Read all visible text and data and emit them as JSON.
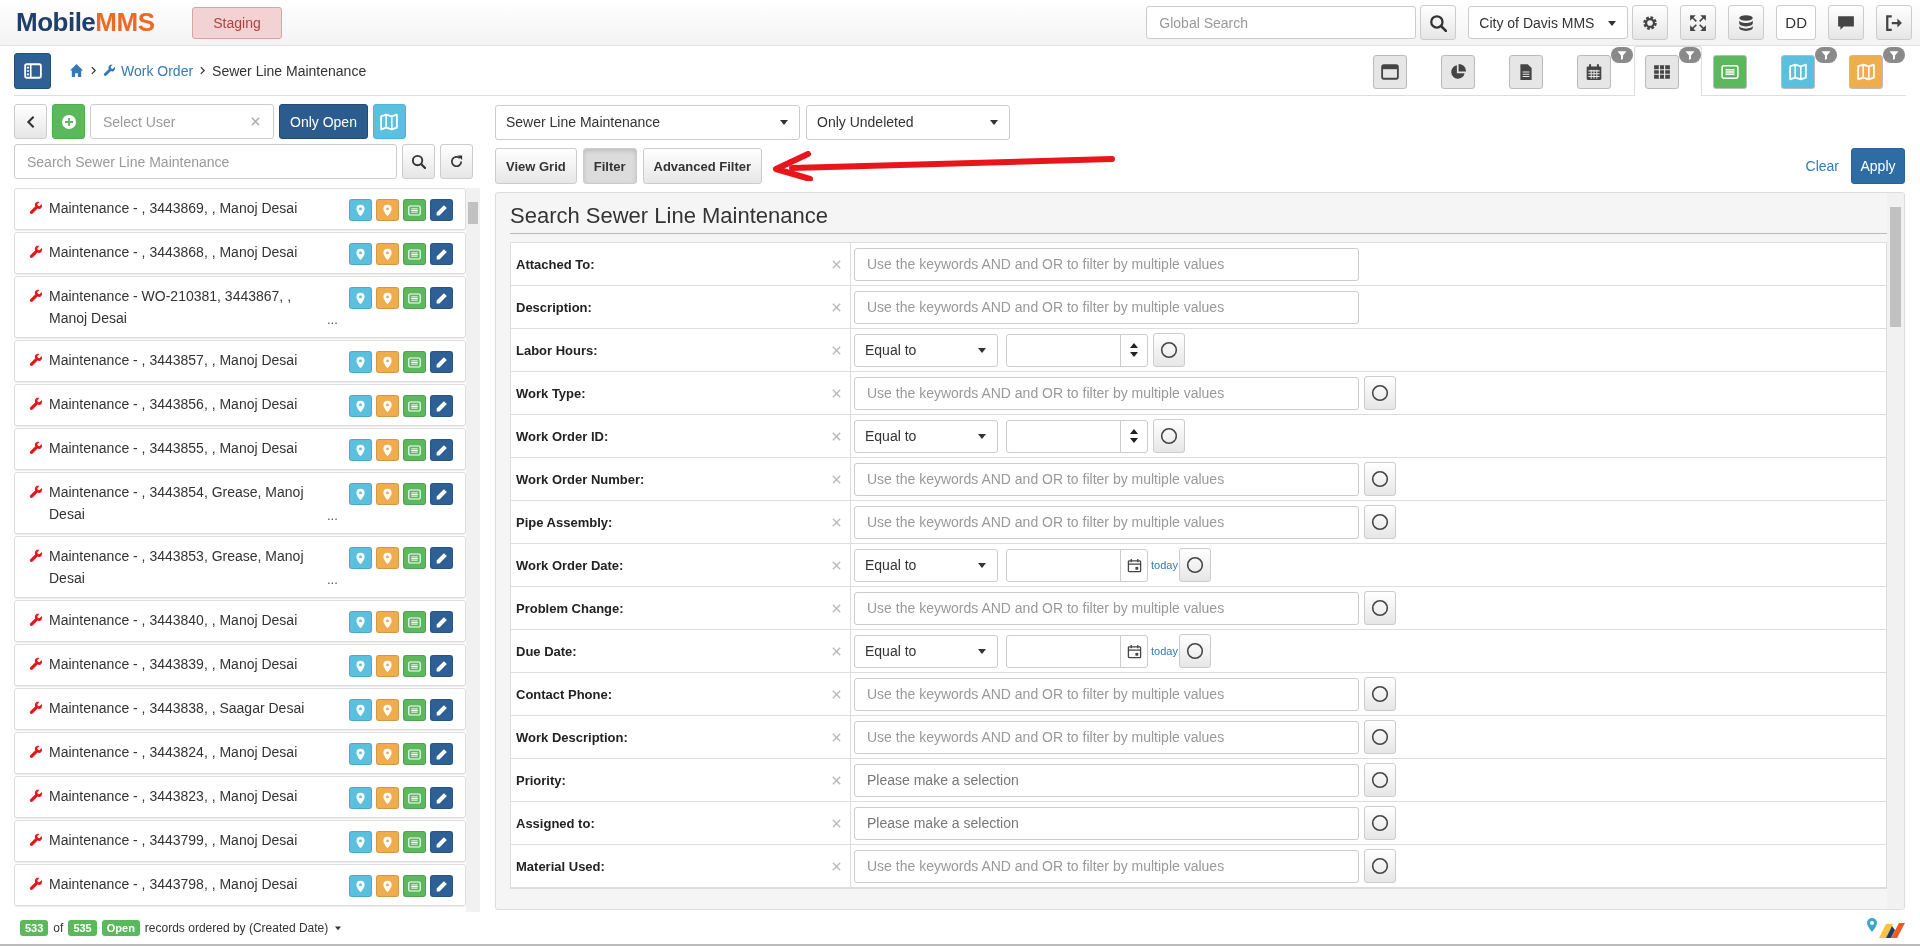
{
  "header": {
    "logo": {
      "brand": "Mobile",
      "product": "MMS"
    },
    "environment": "Staging",
    "global_search": {
      "placeholder": "Global Search"
    },
    "organization": "City of Davis MMS",
    "user_initials": "DD"
  },
  "breadcrumb": {
    "items": [
      "Work Order",
      "Sewer Line Maintenance"
    ]
  },
  "view_toolbar": [
    {
      "kind": "window",
      "color": "#e6e6e6",
      "filter_badge": false,
      "selected": false
    },
    {
      "kind": "pie",
      "color": "#e6e6e6",
      "filter_badge": false,
      "selected": false
    },
    {
      "kind": "document",
      "color": "#e6e6e6",
      "filter_badge": false,
      "selected": false
    },
    {
      "kind": "calendar",
      "color": "#e6e6e6",
      "filter_badge": true,
      "selected": false
    },
    {
      "kind": "grid",
      "color": "#e6e6e6",
      "filter_badge": true,
      "selected": true
    },
    {
      "kind": "list",
      "color": "#5cb85c",
      "filter_badge": false,
      "selected": false
    },
    {
      "kind": "map",
      "color": "#5bc0de",
      "filter_badge": true,
      "selected": false
    },
    {
      "kind": "map",
      "color": "#f0ad4e",
      "filter_badge": true,
      "selected": false
    }
  ],
  "sidebar": {
    "user_select": {
      "placeholder": "Select User"
    },
    "only_open": {
      "label": "Only Open",
      "on": true
    },
    "search": {
      "placeholder": "Search Sewer Line Maintenance"
    },
    "items": [
      {
        "text": "Maintenance - , 3443869, , Manoj Desai"
      },
      {
        "text": "Maintenance - , 3443868, , Manoj Desai"
      },
      {
        "text": "Maintenance - WO-210381, 3443867, , Manoj Desai",
        "ellipsis": "..."
      },
      {
        "text": "Maintenance - , 3443857, , Manoj Desai"
      },
      {
        "text": "Maintenance - , 3443856, , Manoj Desai"
      },
      {
        "text": "Maintenance - , 3443855, , Manoj Desai"
      },
      {
        "text": "Maintenance - , 3443854, Grease, Manoj Desai",
        "ellipsis": "..."
      },
      {
        "text": "Maintenance - , 3443853, Grease, Manoj Desai",
        "ellipsis": "..."
      },
      {
        "text": "Maintenance - , 3443840, , Manoj Desai"
      },
      {
        "text": "Maintenance - , 3443839, , Manoj Desai"
      },
      {
        "text": "Maintenance - , 3443838, , Saagar Desai"
      },
      {
        "text": "Maintenance - , 3443824, , Manoj Desai"
      },
      {
        "text": "Maintenance - , 3443823, , Manoj Desai"
      },
      {
        "text": "Maintenance - , 3443799, , Manoj Desai"
      },
      {
        "text": "Maintenance - , 3443798, , Manoj Desai"
      }
    ]
  },
  "filter_bar": {
    "layer": "Sewer Line Maintenance",
    "deleted_filter": "Only Undeleted",
    "tabs": [
      {
        "label": "View Grid",
        "selected": false
      },
      {
        "label": "Filter",
        "selected": true
      },
      {
        "label": "Advanced Filter",
        "selected": false
      }
    ],
    "clear": "Clear",
    "apply": "Apply"
  },
  "filter_form": {
    "title": "Search Sewer Line Maintenance",
    "fields": [
      {
        "label": "Attached To:",
        "kind": "text",
        "placeholder": "Use the keywords AND and OR to filter by multiple values",
        "toggle": false
      },
      {
        "label": "Description:",
        "kind": "text",
        "placeholder": "Use the keywords AND and OR to filter by multiple values",
        "toggle": false
      },
      {
        "label": "Labor Hours:",
        "kind": "number",
        "operator": "Equal to",
        "toggle": true
      },
      {
        "label": "Work Type:",
        "kind": "text",
        "placeholder": "Use the keywords AND and OR to filter by multiple values",
        "toggle": true
      },
      {
        "label": "Work Order ID:",
        "kind": "number",
        "operator": "Equal to",
        "toggle": true
      },
      {
        "label": "Work Order Number:",
        "kind": "text",
        "placeholder": "Use the keywords AND and OR to filter by multiple values",
        "toggle": true
      },
      {
        "label": "Pipe Assembly:",
        "kind": "text",
        "placeholder": "Use the keywords AND and OR to filter by multiple values",
        "toggle": true
      },
      {
        "label": "Work Order Date:",
        "kind": "date",
        "operator": "Equal to",
        "today": "today",
        "toggle": true
      },
      {
        "label": "Problem Change:",
        "kind": "text",
        "placeholder": "Use the keywords AND and OR to filter by multiple values",
        "toggle": true
      },
      {
        "label": "Due Date:",
        "kind": "date",
        "operator": "Equal to",
        "today": "today",
        "toggle": true
      },
      {
        "label": "Contact Phone:",
        "kind": "text",
        "placeholder": "Use the keywords AND and OR to filter by multiple values",
        "toggle": true
      },
      {
        "label": "Work Description:",
        "kind": "text",
        "placeholder": "Use the keywords AND and OR to filter by multiple values",
        "toggle": true
      },
      {
        "label": "Priority:",
        "kind": "select",
        "placeholder": "Please make a selection",
        "toggle": true
      },
      {
        "label": "Assigned to:",
        "kind": "select",
        "placeholder": "Please make a selection",
        "toggle": true
      },
      {
        "label": "Material Used:",
        "kind": "text",
        "placeholder": "Use the keywords AND and OR to filter by multiple values",
        "toggle": true
      }
    ]
  },
  "status_bar": {
    "shown": "533",
    "of": "of",
    "total": "535",
    "state": "Open",
    "ordering": "records ordered by (Created Date)"
  }
}
